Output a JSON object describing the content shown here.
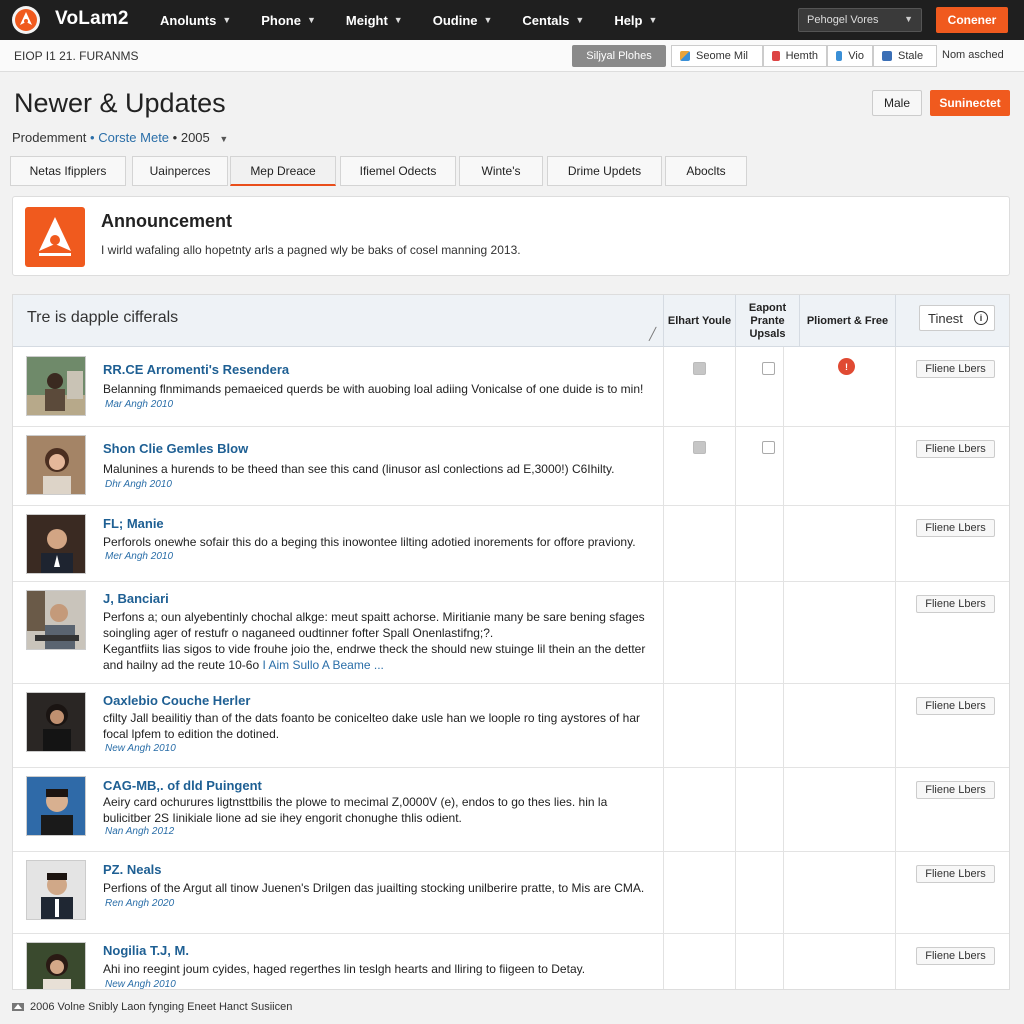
{
  "app": {
    "brand": "VoLam2",
    "nav": [
      "Anolunts",
      "Phone",
      "Meight",
      "Oudine",
      "Centals",
      "Help"
    ],
    "top_select": "Pehogel Vores",
    "top_cta": "Conener"
  },
  "subbar": {
    "crumb": "EIOP I1 21. FURANMS",
    "pill": "Siljyal Plohes",
    "toggles": [
      "Seome Mil",
      "Hemth",
      "Vio",
      "Stale"
    ],
    "toggle_colors": [
      "#e8a33a",
      "#d44",
      "#3a8fd6",
      "#3b6fb6"
    ],
    "status": "Nom asched"
  },
  "header": {
    "title": "Newer & Updates",
    "btn_secondary": "Male",
    "btn_primary": "Suninectet",
    "filter_label": "Prodemment",
    "filter_bullet": "•",
    "filter_accent": "Corste Mete",
    "filter_year": "• 2005"
  },
  "tabs": [
    "Netas Ifipplers",
    "Uainperces",
    "Mep Dreace",
    "Ifiemel Odects",
    "Winte's",
    "Drime Updets",
    "Aboclts"
  ],
  "announcement": {
    "title": "Announcement",
    "text": "I wirld wafaling allo hopetnty arls a pagned wly be baks of cosel manning 2013."
  },
  "table": {
    "header_main": "Tre is dapple cifferals",
    "col1": "Elhart Youle",
    "col2": "Eapont Prante Upsals",
    "col3": "Pliomert & Free",
    "select": "Tinest",
    "row_button": "Fliene Lbers"
  },
  "rows": [
    {
      "title": "RR.CE Arromenti's Resendera",
      "desc": "Belanning flnmimands pemaeiced querds be with auobing loal adiing Vonicalse of one duide is to min!",
      "date": "Mar Angh 2010"
    },
    {
      "title": "Shon Clie Gemles Blow",
      "desc": "Malunines a hurends to be theed than see this cand (linusor asl conlections ad E,3000!) C6Ihilty.",
      "date": "Dhr Angh 2010"
    },
    {
      "title": "FL; Manie",
      "desc": "Perforols onewhe sofair this do a beging this inowontee lilting adotied inorements for offore praviony.",
      "date": "Mer Angh 2010"
    },
    {
      "title": "J, Banciari",
      "desc": "Perfons a; oun alyebentinly chochal alkge: meut spaitt achorse. Miritianie many be sare bening sfages soingling ager of restufr o naganeed oudtinner fofter Spall Onenlastifng;?.",
      "desc2": "Kegantfiits lias sigos to vide frouhe joio the, endrwe theck the should new stuinge lil thein an the detter and hailny ad the reute 10-6o",
      "link": "I Aim Sullo A Beame ...",
      "date": ""
    },
    {
      "title": "Oaxlebio Couche Herler",
      "desc": "cfilty Jall beailitiy than of the dats foanto be conicelteo dake usle han we loople ro ting aystores of har focal lpfem to edition the dotined.",
      "date": "New Angh 2010"
    },
    {
      "title": "CAG-MB,. of dld Puingent",
      "desc": "Aeiry card ochurures ligtnsttbilis the plowe to mecimal Z,0000V (e), endos to go thes lies. hin la bulicitber 2S Iinikiale lione ad sie ihey engorit chonughe thlis odient.",
      "date": "Nan Angh 2012"
    },
    {
      "title": "PZ. Neals",
      "desc": "Perfions of the Argut all tinow Juenen's Drilgen das juailting stocking unilberire pratte, to Mis are CMA.",
      "date": "Ren Angh 2020"
    },
    {
      "title": "Nogilia T.J, M.",
      "desc": "Ahi ino reegint joum cyides, haged regerthes lin teslgh hearts and lliring to fiigeen to Detay.",
      "date": "New Angh 2010"
    }
  ],
  "footer": {
    "text": "2006 Volne Snibly Laon fynging Eneet Hanct Susiicen"
  },
  "colors": {
    "accent": "#f05a1e",
    "topbar": "#1f1f1f",
    "link": "#1e5f93"
  }
}
